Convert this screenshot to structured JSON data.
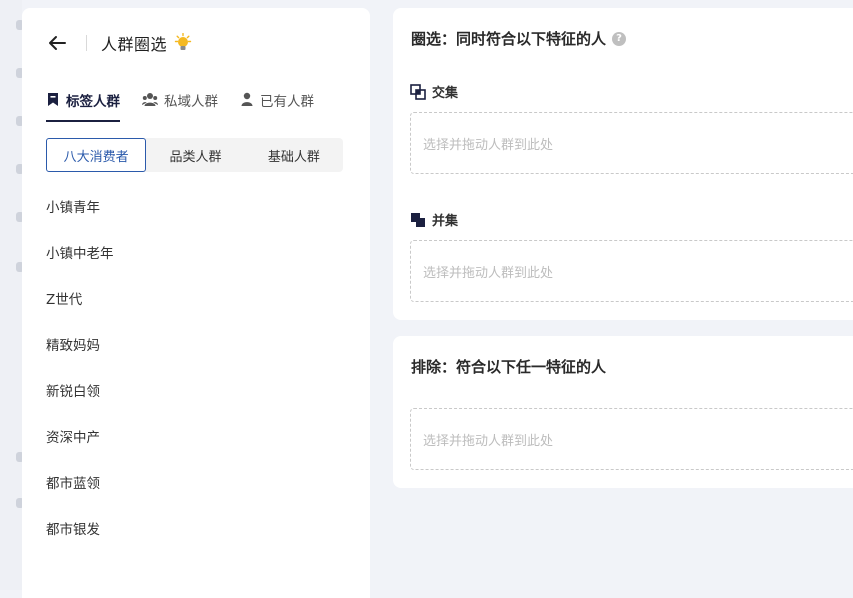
{
  "header": {
    "title": "人群圈选",
    "bulb_icon": "lightbulb-icon"
  },
  "tabs": [
    {
      "label": "标签人群",
      "icon": "bookmark-icon",
      "active": true
    },
    {
      "label": "私域人群",
      "icon": "group-icon",
      "active": false
    },
    {
      "label": "已有人群",
      "icon": "person-icon",
      "active": false
    }
  ],
  "segments": [
    {
      "label": "八大消费者",
      "selected": true
    },
    {
      "label": "品类人群",
      "selected": false
    },
    {
      "label": "基础人群",
      "selected": false
    }
  ],
  "list": [
    "小镇青年",
    "小镇中老年",
    "Z世代",
    "精致妈妈",
    "新锐白领",
    "资深中产",
    "都市蓝领",
    "都市银发"
  ],
  "select_card": {
    "title": "圈选：同时符合以下特征的人",
    "help": "?",
    "intersection_label": "交集",
    "union_label": "并集",
    "drop_placeholder": "选择并拖动人群到此处"
  },
  "exclude_card": {
    "title": "排除：符合以下任一特征的人",
    "drop_placeholder": "选择并拖动人群到此处"
  },
  "colors": {
    "accent": "#2b5aab",
    "dark": "#1b2040",
    "bulb": "#f5b921"
  }
}
